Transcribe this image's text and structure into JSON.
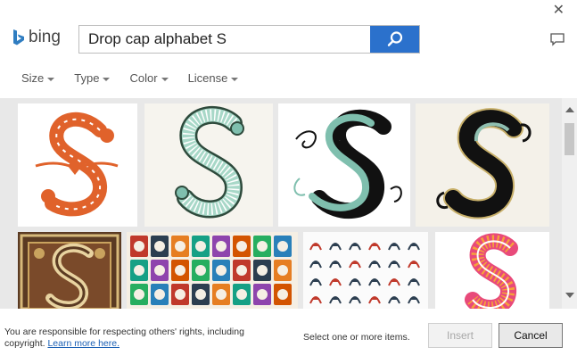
{
  "header": {
    "logo_text": "bing",
    "close_glyph": "✕"
  },
  "search": {
    "query": "Drop cap alphabet S",
    "button_icon": "search-icon"
  },
  "filters": [
    {
      "label": "Size"
    },
    {
      "label": "Type"
    },
    {
      "label": "Color"
    },
    {
      "label": "License"
    }
  ],
  "results": {
    "tiles": [
      {
        "name": "ornate-orange-s"
      },
      {
        "name": "teal-striped-s"
      },
      {
        "name": "black-teal-s"
      },
      {
        "name": "black-gold-s"
      },
      {
        "name": "ornate-brown-s"
      },
      {
        "name": "colorful-alphabet"
      },
      {
        "name": "sketch-alphabet"
      },
      {
        "name": "pink-striped-s"
      }
    ]
  },
  "footer": {
    "notice_text": "You are responsible for respecting others' rights, including copyright.",
    "learn_more_label": "Learn more here.",
    "selection_status": "Select one or more items.",
    "insert_label": "Insert",
    "cancel_label": "Cancel"
  },
  "colors": {
    "accent": "#2b71cc",
    "orange": "#e0622b",
    "teal": "#7fbfae",
    "brown": "#5a3a22",
    "pink": "#e84a7a"
  }
}
